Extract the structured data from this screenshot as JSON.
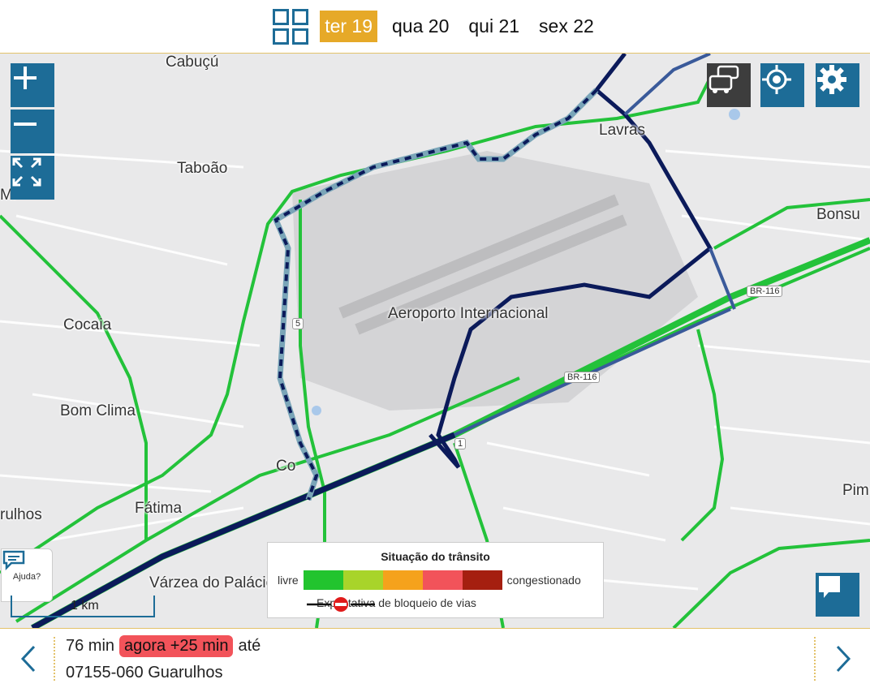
{
  "days": {
    "grid_icon": "grid-icon",
    "items": [
      {
        "label": "ter 19",
        "active": true
      },
      {
        "label": "qua 20",
        "active": false
      },
      {
        "label": "qui 21",
        "active": false
      },
      {
        "label": "sex 22",
        "active": false
      }
    ]
  },
  "map": {
    "labels": {
      "cabucu": "Cabuçú",
      "taboao": "Taboão",
      "mi": "Mi",
      "lavras": "Lavras",
      "bonsu": "Bonsu",
      "aeroporto": "Aeroporto Internacional",
      "cocaia": "Cocaia",
      "bom_clima": "Bom Clima",
      "fatima": "Fátima",
      "rulhos": "rulhos",
      "varzea": "Várzea do Palácio",
      "pim": "Pim",
      "co": "Co"
    },
    "shields": {
      "br116_a": "BR-116",
      "br116_b": "BR-116",
      "sp": "5",
      "br_c": "1"
    },
    "controls": {
      "zoom_in": "plus-icon",
      "zoom_out": "minus-icon",
      "fit": "expand-icon",
      "traffic": "car-traffic-icon",
      "locate": "target-icon",
      "settings": "gear-icon"
    },
    "colors": {
      "route_main": "#0b1a5a",
      "route_alt": "#3a5a9a",
      "traffic_free": "#23c23a",
      "accent": "#1d6c97"
    }
  },
  "legend": {
    "title": "Situação do trânsito",
    "free": "livre",
    "congested": "congestionado",
    "scale_colors": [
      "#22c42e",
      "#a8d42a",
      "#f5a21c",
      "#f2535a",
      "#a51f10"
    ],
    "block_text": "Expectativa de bloqueio de vias"
  },
  "help": {
    "label": "Ajuda?"
  },
  "scale": {
    "label": "1 km"
  },
  "trip": {
    "duration": "76 min",
    "delay": "agora +25 min",
    "until": "até",
    "destination": "07155-060 Guarulhos"
  }
}
